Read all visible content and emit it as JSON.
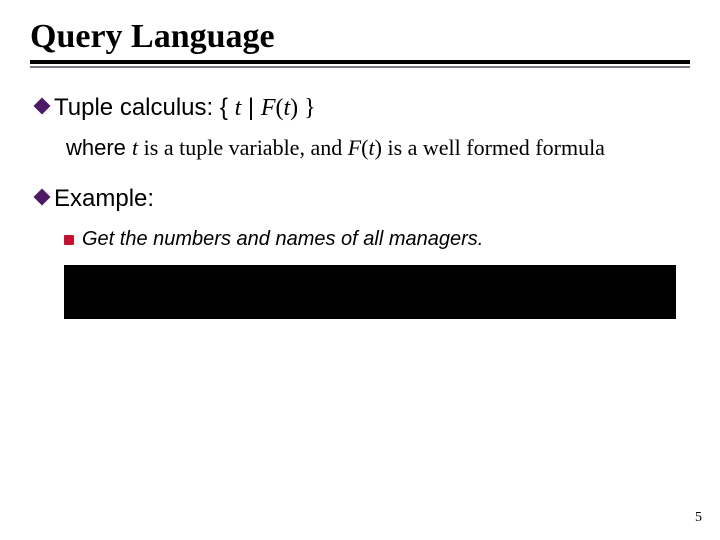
{
  "title": "Query Language",
  "bullets": {
    "tuple_calc": {
      "lead": "Tuple",
      "label": " calculus: { ",
      "t": "t",
      "sep": " | ",
      "F": "F",
      "paren_open": "(",
      "t2": "t",
      "paren_close": ") }"
    },
    "where": {
      "where_word": "where ",
      "t": "t",
      "mid": " is a tuple variable, and ",
      "F": "F",
      "paren": "(",
      "t2": "t",
      "close": ")",
      "tail": " is a well formed formula"
    },
    "example_label": "Example:",
    "example_item": "Get the numbers and names of all managers."
  },
  "page_number": "5"
}
